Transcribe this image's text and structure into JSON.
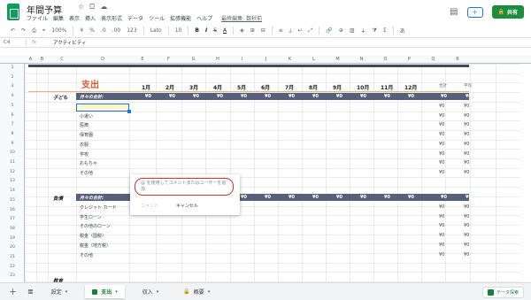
{
  "header": {
    "doc_title": "年間予算",
    "title_icons": [
      "star-icon",
      "folder-move-icon",
      "cloud-status-icon"
    ],
    "menu": [
      "ファイル",
      "編集",
      "表示",
      "挿入",
      "表示形式",
      "データ",
      "ツール",
      "拡張機能",
      "ヘルプ"
    ],
    "last_edit": "最終編集: 数秒前",
    "share_label": "共有",
    "share_icon": "lock-icon"
  },
  "toolbar": {
    "zoom": "100%",
    "currency": "¥",
    "percent": "%",
    "decimals_dec": ".0",
    "decimals_inc": ".00",
    "number_format": "123",
    "font": "Lato",
    "font_size": "10",
    "bold": "B",
    "italic": "I",
    "strike": "S",
    "text_color": "A"
  },
  "formula_bar": {
    "cell_ref": "C4",
    "fx": "fx",
    "value": "アクティビティ"
  },
  "sheet": {
    "columns": [
      "A",
      "B",
      "C",
      "D",
      "E",
      "F",
      "G",
      "H",
      "I",
      "J",
      "K",
      "L",
      "M",
      "N",
      "O",
      "P",
      "Q",
      "R"
    ],
    "rows": [
      "1",
      "2",
      "3",
      "4",
      "5",
      "6",
      "7",
      "8",
      "9",
      "10",
      "11",
      "12",
      "13",
      "14",
      "15",
      "16",
      "17",
      "18",
      "19",
      "20",
      "21",
      "22",
      "23"
    ],
    "title": "支出",
    "months": [
      "1月",
      "2月",
      "3月",
      "4月",
      "5月",
      "6月",
      "7月",
      "8月",
      "9月",
      "10月",
      "11月",
      "12月"
    ],
    "summary_headers": [
      "合計",
      "平均"
    ],
    "yen_zero": "¥0",
    "groups": [
      {
        "label": "子ども",
        "total_label": "月々の合計:",
        "items": [
          "アクティビティ",
          "小遣い",
          "医療",
          "保育園",
          "衣服",
          "学校",
          "おもちゃ",
          "その他"
        ]
      },
      {
        "label": "負債",
        "total_label": "月々の合計:",
        "items": [
          "クレジット カード",
          "学生ローン",
          "その他のローン",
          "税金（国税）",
          "税金（地方税）",
          "その他"
        ]
      }
    ],
    "next_group_label": "教育"
  },
  "comment": {
    "placeholder": "@ を使用してコメントまたはユーザーを追加",
    "submit_label": "コメント",
    "cancel_label": "キャンセル"
  },
  "tabs": {
    "items": [
      {
        "label": "設定",
        "active": false
      },
      {
        "label": "支出",
        "active": true
      },
      {
        "label": "収入",
        "active": false
      },
      {
        "label": "概要",
        "active": false
      }
    ],
    "explore_label": "データ探索"
  },
  "colors": {
    "accent_green": "#188038",
    "title_orange": "#e4572e",
    "header_band": "#56607a",
    "dark_band": "#3d4b63",
    "highlight": "#fff6cc",
    "comment_border": "#d93025"
  }
}
